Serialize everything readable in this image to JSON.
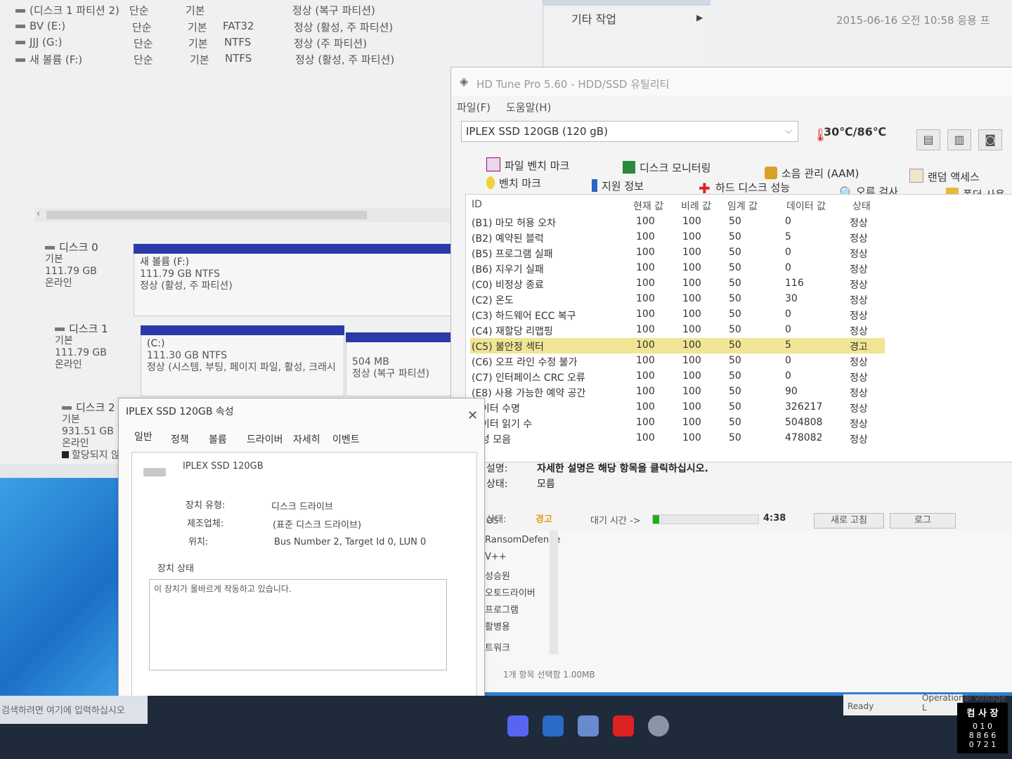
{
  "disk_mgmt": {
    "volumes": [
      {
        "name": "(디스크 1 파티션 2)",
        "layout": "단순",
        "type": "기본",
        "fs": "",
        "status": "정상 (복구 파티션)"
      },
      {
        "name": "BV (E:)",
        "layout": "단순",
        "type": "기본",
        "fs": "FAT32",
        "status": "정상 (활성, 주 파티션)"
      },
      {
        "name": "JJJ (G:)",
        "layout": "단순",
        "type": "기본",
        "fs": "NTFS",
        "status": "정상 (주 파티션)"
      },
      {
        "name": "새 볼륨 (F:)",
        "layout": "단순",
        "type": "기본",
        "fs": "NTFS",
        "status": "정상 (활성, 주 파티션)"
      }
    ],
    "disks": [
      {
        "name": "디스크 0",
        "type": "기본",
        "size": "111.79 GB",
        "state": "온라인"
      },
      {
        "name": "디스크 1",
        "type": "기본",
        "size": "111.79 GB",
        "state": "온라인"
      },
      {
        "name": "디스크 2",
        "type": "기본",
        "size": "931.51 GB",
        "state": "온라인",
        "extra": "할당되지 않"
      }
    ],
    "partitions": {
      "d0p1": {
        "title": "새 볼륨  (F:)",
        "size": "111.79 GB NTFS",
        "status": "정상 (활성, 주 파티션)"
      },
      "d1p1": {
        "title": "(C:)",
        "size": "111.30 GB NTFS",
        "status": "정상 (시스템, 부팅, 페이지 파일, 활성, 크래시"
      },
      "d1p2": {
        "title": "",
        "size": "504 MB",
        "status": "정상 (복구 파티션)"
      }
    },
    "menu_item": "기타 작업",
    "datetime": "2015-06-16 오전 10:58   응용 프"
  },
  "hdtune": {
    "title": "HD Tune Pro 5.60 - HDD/SSD 유틸리티",
    "menu": [
      "파일(F)",
      "도움말(H)"
    ],
    "drive": "IPLEX SSD 120GB (120 gB)",
    "temp": "30℃/86℃",
    "tabs_row1": [
      "파일 벤치 마크",
      "디스크 모니터링",
      "소음 관리 (AAM)",
      "랜덤 액세스"
    ],
    "tabs_row2": [
      "벤치 마크",
      "지원 정보",
      "하드 디스크 성능",
      "오류 검사",
      "폴더 사용"
    ],
    "smart_headers": [
      "ID",
      "현재 값",
      "비례 값",
      "임계 값",
      "데이터 값",
      "상태"
    ],
    "smart_rows": [
      {
        "id": "(B1) 마모 허용 오차",
        "cur": "100",
        "worst": "100",
        "thr": "50",
        "data": "0",
        "status": "정상"
      },
      {
        "id": "(B2) 예약된 블럭",
        "cur": "100",
        "worst": "100",
        "thr": "50",
        "data": "5",
        "status": "정상"
      },
      {
        "id": "(B5) 프로그램 실패",
        "cur": "100",
        "worst": "100",
        "thr": "50",
        "data": "0",
        "status": "정상"
      },
      {
        "id": "(B6) 지우기 실패",
        "cur": "100",
        "worst": "100",
        "thr": "50",
        "data": "0",
        "status": "정상"
      },
      {
        "id": "(C0) 비정상 종료",
        "cur": "100",
        "worst": "100",
        "thr": "50",
        "data": "116",
        "status": "정상"
      },
      {
        "id": "(C2) 온도",
        "cur": "100",
        "worst": "100",
        "thr": "50",
        "data": "30",
        "status": "정상"
      },
      {
        "id": "(C3) 하드웨어 ECC 복구",
        "cur": "100",
        "worst": "100",
        "thr": "50",
        "data": "0",
        "status": "정상"
      },
      {
        "id": "(C4) 재할당 리맵핑",
        "cur": "100",
        "worst": "100",
        "thr": "50",
        "data": "0",
        "status": "정상"
      },
      {
        "id": "(C5) 불안정 섹터",
        "cur": "100",
        "worst": "100",
        "thr": "50",
        "data": "5",
        "status": "경고"
      },
      {
        "id": "(C6) 오프 라인 수정 불가",
        "cur": "100",
        "worst": "100",
        "thr": "50",
        "data": "0",
        "status": "정상"
      },
      {
        "id": "(C7) 인터페이스 CRC 오류",
        "cur": "100",
        "worst": "100",
        "thr": "50",
        "data": "0",
        "status": "정상"
      },
      {
        "id": "(E8) 사용 가능한 예약 공간",
        "cur": "100",
        "worst": "100",
        "thr": "50",
        "data": "90",
        "status": "정상"
      },
      {
        "id": "데이터 수명",
        "cur": "100",
        "worst": "100",
        "thr": "50",
        "data": "326217",
        "status": "정상"
      },
      {
        "id": "데이터 읽기 수",
        "cur": "100",
        "worst": "100",
        "thr": "50",
        "data": "504808",
        "status": "정상"
      },
      {
        "id": "속성 모음",
        "cur": "100",
        "worst": "100",
        "thr": "50",
        "data": "478082",
        "status": "정상"
      }
    ],
    "desc_label": "설명:",
    "desc_text": "자세한 설명은 해당 항목을 클릭하십시오.",
    "state_label": "상태:",
    "state_text": "모름",
    "status_label": "상태:",
    "status_value": "경고",
    "wait_label": "대기 시간 ->",
    "time": "4:38",
    "refresh_btn": "새로 고침",
    "log_btn": "로그"
  },
  "explorer": {
    "items": [
      "OS",
      "RansomDefende",
      "V++",
      "성승원",
      "오토드라이버",
      "프로그램",
      "활병용",
      "트워크"
    ],
    "footer": "1개 항목 선택함 1.00MB"
  },
  "props": {
    "title": "IPLEX SSD 120GB 속성",
    "tabs": [
      "일반",
      "정책",
      "볼륨",
      "드라이버",
      "자세히",
      "이벤트"
    ],
    "device_name": "IPLEX SSD 120GB",
    "rows": [
      {
        "label": "장치 유형:",
        "value": "디스크 드라이브"
      },
      {
        "label": "제조업체:",
        "value": "(표준 디스크 드라이브)"
      },
      {
        "label": "위치:",
        "value": "Bus Number 2, Target Id 0, LUN 0"
      }
    ],
    "status_group": "장치 상태",
    "status_text": "이 장치가 올바르게 작동하고 있습니다."
  },
  "taskbar": {
    "search_placeholder": "검색하려면 여기에 입력하십시오",
    "ready": "Ready",
    "op_voltage": "Operational Voltage L"
  },
  "stamp": {
    "line1": "컴 사 장",
    "line2": "0 1 0",
    "line3": "8 8 6 6",
    "line4": "0 7 2 1"
  },
  "colors": {
    "disk_bar": "#2a3aa8",
    "warn_row": "#f0e594",
    "taskbar": "#1f2a3a"
  }
}
